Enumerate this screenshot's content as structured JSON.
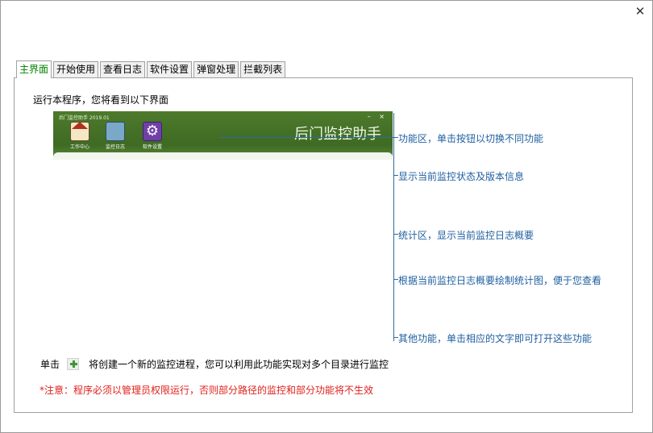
{
  "window": {
    "close_glyph": "✕"
  },
  "tabs": [
    {
      "label": "主界面",
      "active": true
    },
    {
      "label": "开始使用",
      "active": false
    },
    {
      "label": "查看日志",
      "active": false
    },
    {
      "label": "软件设置",
      "active": false
    },
    {
      "label": "弹窗处理",
      "active": false
    },
    {
      "label": "拦截列表",
      "active": false
    }
  ],
  "intro_text": "运行本程序，您将看到以下界面",
  "preview": {
    "title": "后门监控助手 2019.01",
    "window_controls": "– ×",
    "brand": "后门监控助手",
    "toolbar": [
      {
        "label": "工作中心",
        "icon": "home-icon"
      },
      {
        "label": "监控日志",
        "icon": "log-icon"
      },
      {
        "label": "软件设置",
        "icon": "gear-icon"
      }
    ]
  },
  "annotations": [
    "功能区，单击按钮以切换不同功能",
    "显示当前监控状态及版本信息",
    "统计区，显示当前监控日志概要",
    "根据当前监控日志概要绘制统计图，便于您查看",
    "其他功能，单击相应的文字即可打开这些功能"
  ],
  "add_instruction": {
    "prefix": "单击",
    "suffix": "将创建一个新的监控进程，您可以利用此功能实现对多个目录进行监控"
  },
  "warning": "*注意：程序必须以管理员权限运行，否则部分路径的监控和部分功能将不生效",
  "colors": {
    "active_tab": "#008000",
    "annotation": "#1f5fa0",
    "warning": "#e0201c"
  }
}
